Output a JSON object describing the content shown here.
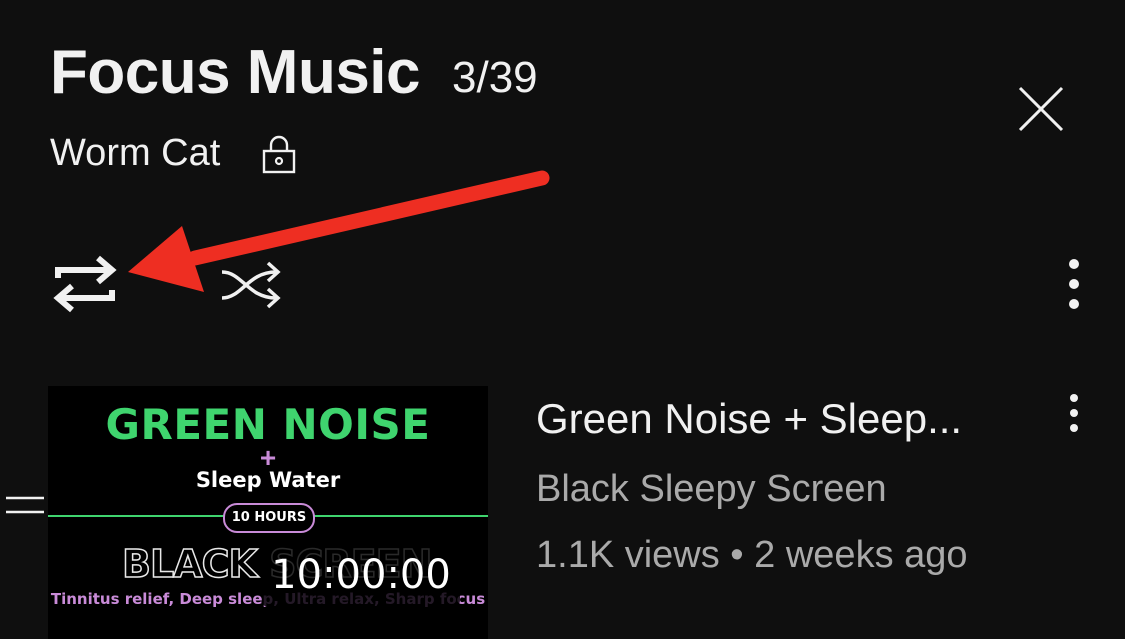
{
  "header": {
    "title": "Focus Music",
    "count": "3/39",
    "owner": "Worm Cat",
    "owner_icon": "lock-icon"
  },
  "controls": {
    "repeat_icon": "repeat-icon",
    "shuffle_icon": "shuffle-icon",
    "more_icon": "more-vertical-icon",
    "close_icon": "close-icon"
  },
  "annotation": {
    "arrow_color": "#ee2e22"
  },
  "item": {
    "thumbnail": {
      "headline": "GREEN NOISE",
      "plus": "+",
      "subline": "Sleep Water",
      "badge": "10 HOURS",
      "bottom_text": "BLACK SCREEN",
      "tagline": "Tinnitus relief, Deep sleep, Ultra relax, Sharp focus",
      "duration": "10:00:00"
    },
    "title": "Green Noise + Sleep...",
    "channel": "Black Sleepy Screen",
    "meta": "1.1K views • 2 weeks ago"
  },
  "colors": {
    "background": "#0f0f0f",
    "primary_text": "#f1f1f1",
    "secondary_text": "#aaaaaa",
    "thumb_green": "#3fd46e",
    "thumb_purple": "#c98bd8"
  }
}
